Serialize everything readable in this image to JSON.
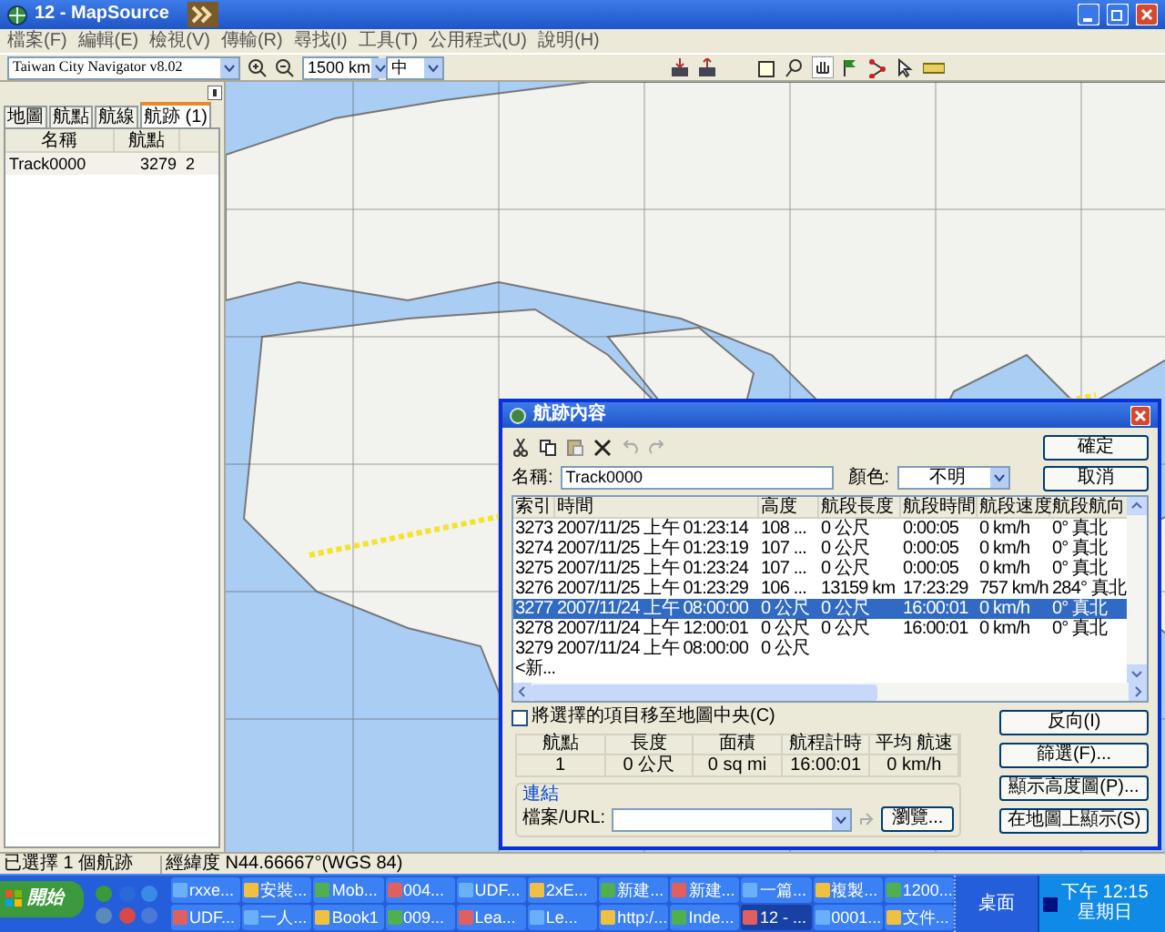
{
  "window": {
    "title": "12 - MapSource"
  },
  "menu": [
    "檔案(F)",
    "編輯(E)",
    "檢視(V)",
    "傳輸(R)",
    "尋找(I)",
    "工具(T)",
    "公用程式(U)",
    "說明(H)"
  ],
  "toolbar": {
    "product": "Taiwan City Navigator v8.02",
    "scale": "1500 km",
    "detail": "中"
  },
  "sidebar": {
    "tabs": [
      {
        "label": "地圖",
        "selected": false
      },
      {
        "label": "航點",
        "selected": false
      },
      {
        "label": "航線",
        "selected": false
      },
      {
        "label": "航跡 (1)",
        "selected": true
      }
    ],
    "columns": [
      "名稱",
      "航點"
    ],
    "rows": [
      {
        "cells": [
          "Track0000",
          "3279",
          "2"
        ]
      }
    ]
  },
  "map": {
    "kind": "picture"
  },
  "dialog": {
    "title": "航跡內容",
    "name_label": "名稱:",
    "name_value": "Track0000",
    "color_label": "顏色:",
    "color_value": "不明",
    "top_buttons": [
      "確定",
      "取消"
    ],
    "columns": [
      "索引",
      "時間",
      "高度",
      "航段長度",
      "航段時間",
      "航段速度",
      "航段航向"
    ],
    "rows": [
      {
        "cells": [
          "3273",
          "2007/11/25 上午 01:23:14",
          "108 ...",
          "0 公尺",
          "0:00:05",
          "0 km/h",
          "0° 真北"
        ],
        "selected": false
      },
      {
        "cells": [
          "3274",
          "2007/11/25 上午 01:23:19",
          "107 ...",
          "0 公尺",
          "0:00:05",
          "0 km/h",
          "0° 真北"
        ],
        "selected": false
      },
      {
        "cells": [
          "3275",
          "2007/11/25 上午 01:23:24",
          "107 ...",
          "0 公尺",
          "0:00:05",
          "0 km/h",
          "0° 真北"
        ],
        "selected": false
      },
      {
        "cells": [
          "3276",
          "2007/11/25 上午 01:23:29",
          "106 ...",
          "13159 km",
          "17:23:29",
          "757 km/h",
          "284° 真北"
        ],
        "selected": false
      },
      {
        "cells": [
          "3277",
          "2007/11/24 上午 08:00:00",
          "0 公尺",
          "0 公尺",
          "16:00:01",
          "0 km/h",
          "0° 真北"
        ],
        "selected": true
      },
      {
        "cells": [
          "3278",
          "2007/11/24 上午 12:00:01",
          "0 公尺",
          "0 公尺",
          "16:00:01",
          "0 km/h",
          "0° 真北"
        ],
        "selected": false
      },
      {
        "cells": [
          "3279",
          "2007/11/24 上午 08:00:00",
          "0 公尺"
        ],
        "selected": false
      },
      {
        "cells": [
          "<新..."
        ],
        "selected": false
      }
    ],
    "checkbox": {
      "label": "將選擇的項目移至地圖中央(C)",
      "checked": false
    },
    "stats": {
      "columns": [
        "航點",
        "長度",
        "面積",
        "航程計時",
        "平均 航速"
      ],
      "values": [
        "1",
        "0 公尺",
        "0 sq mi",
        "16:00:01",
        "0 km/h"
      ]
    },
    "link": {
      "group": "連結",
      "label": "檔案/URL:",
      "browse": "瀏覽..."
    },
    "side_buttons": [
      "反向(I)",
      "篩選(F)...",
      "顯示高度圖(P)...",
      "在地圖上顯示(S)"
    ]
  },
  "status_bar": [
    "已選擇 1 個航跡",
    "經緯度 N44.66667°(WGS 84)"
  ],
  "taskbar": {
    "start": "開始",
    "tasks": [
      {
        "label": "rxxe...",
        "selected": false
      },
      {
        "label": "安裝...",
        "selected": false
      },
      {
        "label": "Mob...",
        "selected": false
      },
      {
        "label": "004...",
        "selected": false
      },
      {
        "label": "UDF...",
        "selected": false
      },
      {
        "label": "2xE...",
        "selected": false
      },
      {
        "label": "新建...",
        "selected": false
      },
      {
        "label": "新建...",
        "selected": false
      },
      {
        "label": "一篇...",
        "selected": false
      },
      {
        "label": "複製...",
        "selected": false
      },
      {
        "label": "1200...",
        "selected": false
      },
      {
        "label": "UDF...",
        "selected": false
      },
      {
        "label": "一人...",
        "selected": false
      },
      {
        "label": "Book1",
        "selected": false
      },
      {
        "label": "009...",
        "selected": false
      },
      {
        "label": "Lea...",
        "selected": false
      },
      {
        "label": "Le...",
        "selected": false
      },
      {
        "label": "http:/...",
        "selected": false
      },
      {
        "label": "Inde...",
        "selected": false
      },
      {
        "label": "12 - ...",
        "selected": true
      },
      {
        "label": "0001...",
        "selected": false
      },
      {
        "label": "文件...",
        "selected": false
      }
    ],
    "desk_band": "桌面",
    "clock": {
      "time": "下午 12:15",
      "day": "星期日"
    }
  }
}
